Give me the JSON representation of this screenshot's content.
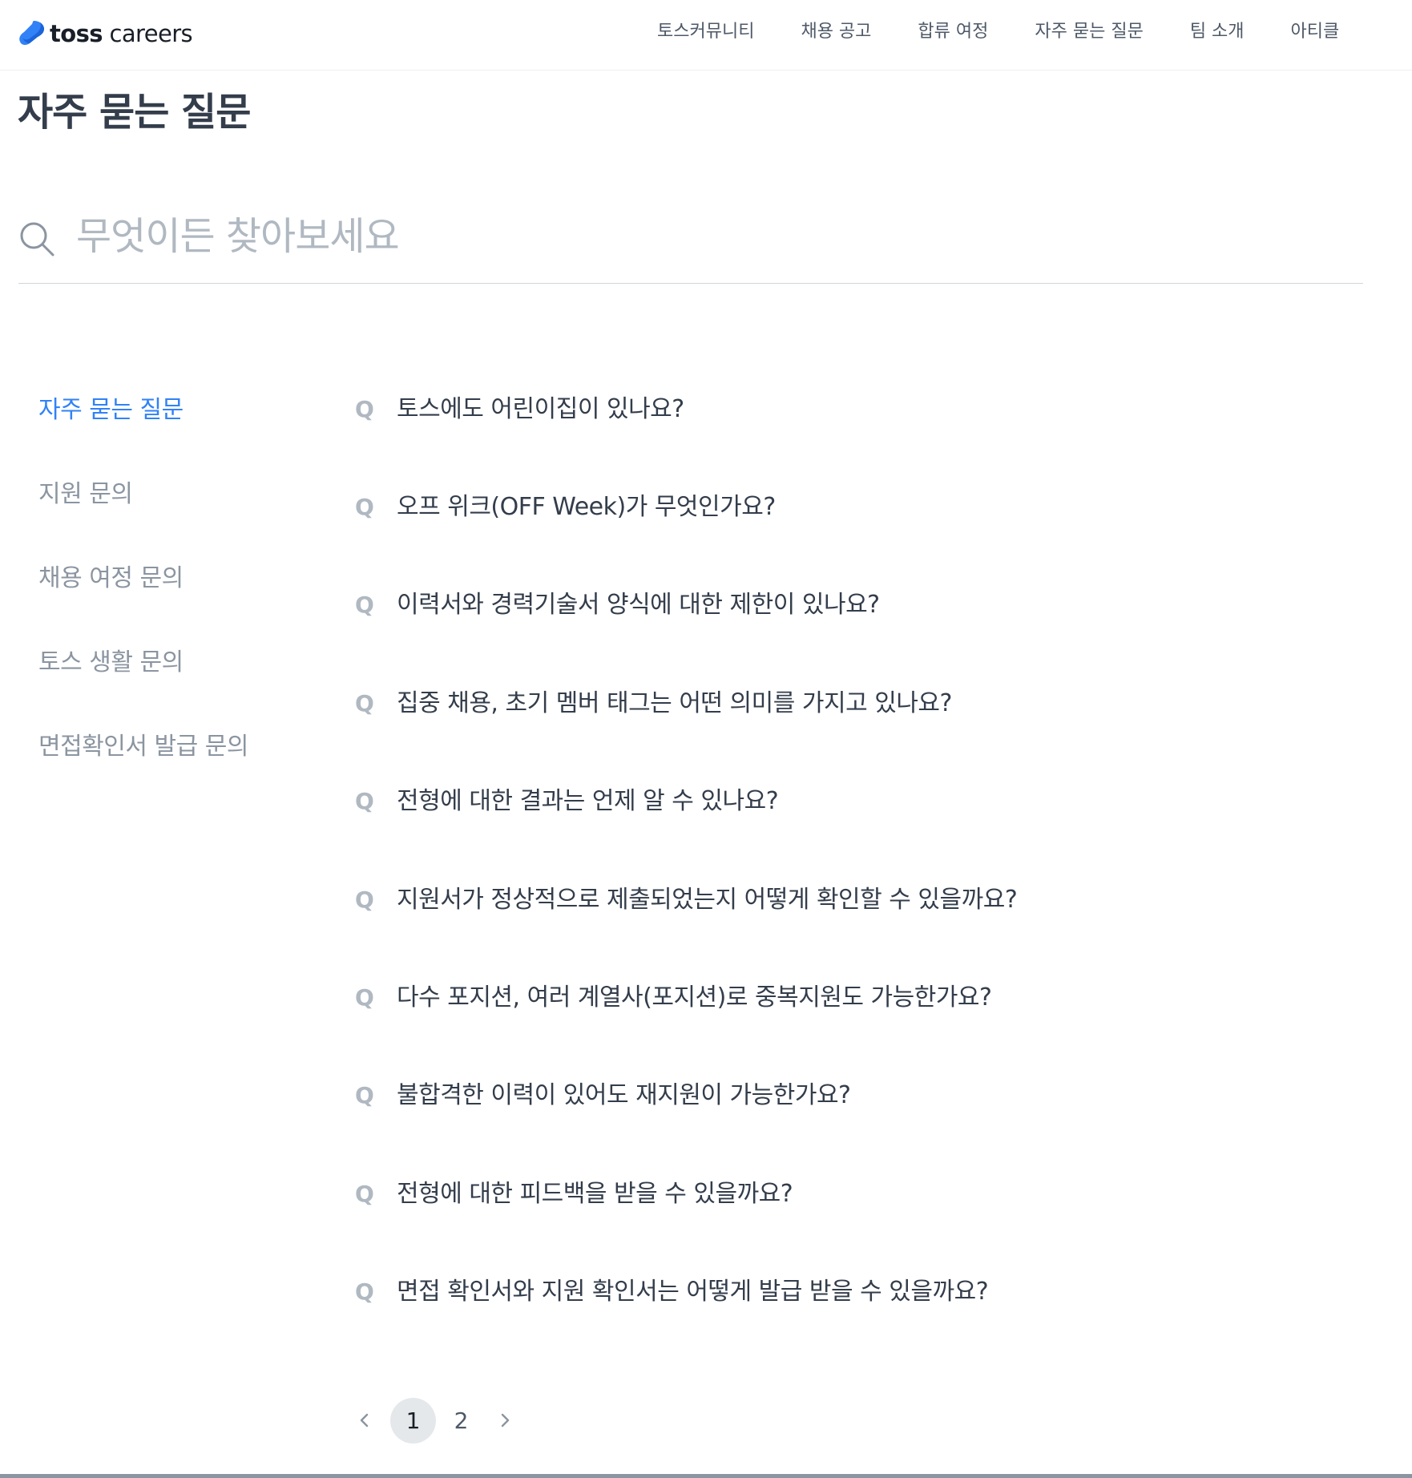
{
  "header": {
    "logo": {
      "brand": "toss",
      "suffix": "careers",
      "icon": "toss-logo-icon",
      "brand_color": "#3182f6"
    },
    "nav": [
      {
        "label": "토스커뮤니티"
      },
      {
        "label": "채용 공고"
      },
      {
        "label": "합류 여정"
      },
      {
        "label": "자주 묻는 질문"
      },
      {
        "label": "팀 소개"
      },
      {
        "label": "아티클"
      }
    ]
  },
  "page": {
    "title": "자주 묻는 질문"
  },
  "search": {
    "placeholder": "무엇이든 찾아보세요",
    "value": "",
    "icon": "search-icon"
  },
  "sidebar": {
    "active_color": "#3182f6",
    "items": [
      {
        "label": "자주 묻는 질문",
        "active": true
      },
      {
        "label": "지원 문의",
        "active": false
      },
      {
        "label": "채용 여정 문의",
        "active": false
      },
      {
        "label": "토스 생활 문의",
        "active": false
      },
      {
        "label": "면접확인서 발급 문의",
        "active": false
      }
    ]
  },
  "faq": {
    "marker": "Q",
    "questions": [
      {
        "text": "토스에도 어린이집이 있나요?"
      },
      {
        "text": "오프 위크(OFF Week)가 무엇인가요?"
      },
      {
        "text": "이력서와 경력기술서 양식에 대한 제한이 있나요?"
      },
      {
        "text": "집중 채용, 초기 멤버 태그는 어떤 의미를 가지고 있나요?"
      },
      {
        "text": "전형에 대한 결과는 언제 알 수 있나요?"
      },
      {
        "text": "지원서가 정상적으로 제출되었는지 어떻게 확인할 수 있을까요?"
      },
      {
        "text": "다수 포지션, 여러 계열사(포지션)로 중복지원도 가능한가요?"
      },
      {
        "text": "불합격한 이력이 있어도 재지원이 가능한가요?"
      },
      {
        "text": "전형에 대한 피드백을 받을 수 있을까요?"
      },
      {
        "text": "면접 확인서와 지원 확인서는 어떻게 발급 받을 수 있을까요?"
      }
    ]
  },
  "pagination": {
    "current": "1",
    "pages": [
      "1",
      "2"
    ],
    "prev_icon": "chevron-left-icon",
    "next_icon": "chevron-right-icon"
  }
}
